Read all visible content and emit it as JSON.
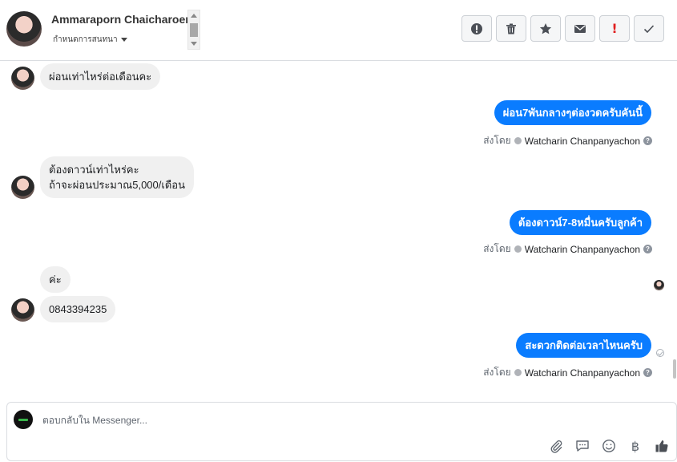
{
  "header": {
    "contact_name": "Ammaraporn Chaicharoen",
    "conversation_control": "กำหนดการสนทนา",
    "toolbar": [
      {
        "name": "report-spam-button",
        "icon": "alert-circle-icon"
      },
      {
        "name": "delete-button",
        "icon": "trash-icon"
      },
      {
        "name": "star-button",
        "icon": "star-icon"
      },
      {
        "name": "mark-unread-button",
        "icon": "envelope-icon"
      },
      {
        "name": "follow-up-button",
        "icon": "exclamation-icon"
      },
      {
        "name": "mark-done-button",
        "icon": "checkmark-icon"
      }
    ]
  },
  "messages": [
    {
      "direction": "in",
      "lines": [
        "ผ่อนเท่าไหร่ต่อเดือนคะ"
      ]
    },
    {
      "direction": "out",
      "lines": [
        "ผ่อน7พันกลางๆต่องวดครับคันนี้"
      ],
      "sent_by_label": "ส่งโดย",
      "sent_by_name": "Watcharin Chanpanyachon"
    },
    {
      "direction": "in",
      "lines": [
        "ต้องดาวน์เท่าไหร่คะ",
        "ถ้าจะผ่อนประมาณ5,000/เดือน"
      ]
    },
    {
      "direction": "out",
      "lines": [
        "ต้องดาวน์7-8หมื่นครับลูกค้า"
      ],
      "sent_by_label": "ส่งโดย",
      "sent_by_name": "Watcharin Chanpanyachon"
    },
    {
      "direction": "in",
      "lines": [
        "ค่ะ"
      ]
    },
    {
      "direction": "in",
      "lines": [
        "0843394235"
      ]
    },
    {
      "direction": "out",
      "lines": [
        "สะดวกติดต่อเวลาไหนครับ"
      ],
      "sent_by_label": "ส่งโดย",
      "sent_by_name": "Watcharin Chanpanyachon"
    }
  ],
  "composer": {
    "placeholder": "ตอบกลับใน Messenger...",
    "tools": [
      "paperclip-icon",
      "saved-reply-icon",
      "emoji-icon",
      "baht-payment-icon",
      "thumbs-up-icon"
    ],
    "baht_symbol": "฿"
  },
  "colors": {
    "outgoing_bubble": "#0a7cff",
    "incoming_bubble": "#f0f0f0",
    "alert_red": "#e02020"
  }
}
